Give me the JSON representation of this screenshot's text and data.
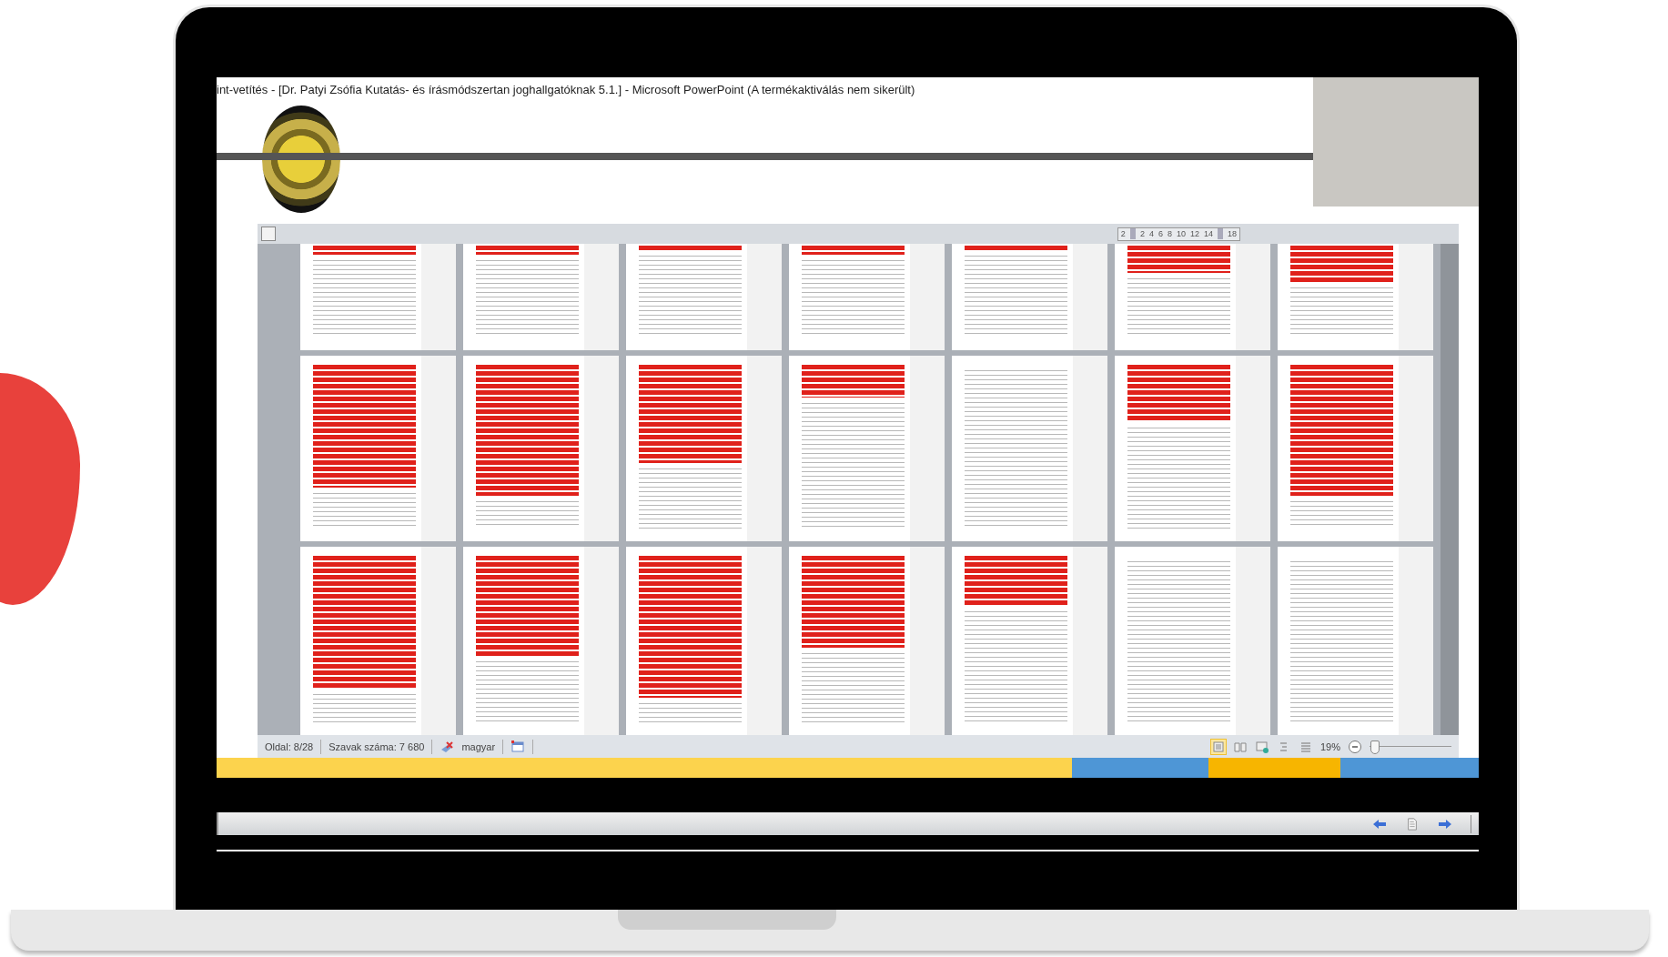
{
  "window": {
    "title": "int-vetítés - [Dr. Patyi Zsófia Kutatás- és írásmódszertan joghallgatóknak 5.1.] - Microsoft PowerPoint (A termékaktiválás nem sikerült)"
  },
  "ruler": [
    "2",
    "2",
    "4",
    "6",
    "8",
    "10",
    "12",
    "14",
    "18"
  ],
  "status_bar": {
    "page": "Oldal: 8/28",
    "words": "Szavak száma: 7 680",
    "language": "magyar",
    "zoom": "19%",
    "zoom_slider": {
      "level": 0.05
    }
  }
}
